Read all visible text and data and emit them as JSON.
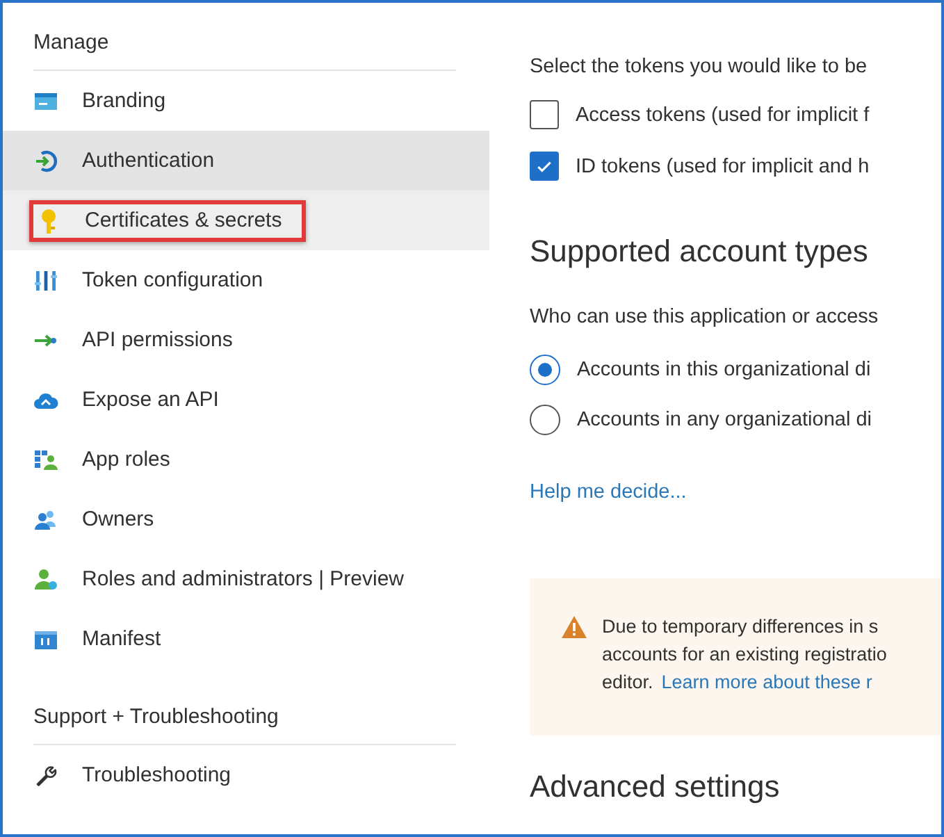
{
  "sidebar": {
    "sections": [
      {
        "title": "Manage",
        "items": [
          {
            "label": "Branding",
            "hovered": false,
            "selected": false,
            "annotated": false
          },
          {
            "label": "Authentication",
            "hovered": true,
            "selected": false,
            "annotated": false
          },
          {
            "label": "Certificates & secrets",
            "hovered": false,
            "selected": true,
            "annotated": true
          },
          {
            "label": "Token configuration",
            "hovered": false,
            "selected": false,
            "annotated": false
          },
          {
            "label": "API permissions",
            "hovered": false,
            "selected": false,
            "annotated": false
          },
          {
            "label": "Expose an API",
            "hovered": false,
            "selected": false,
            "annotated": false
          },
          {
            "label": "App roles",
            "hovered": false,
            "selected": false,
            "annotated": false
          },
          {
            "label": "Owners",
            "hovered": false,
            "selected": false,
            "annotated": false
          },
          {
            "label": "Roles and administrators | Preview",
            "hovered": false,
            "selected": false,
            "annotated": false
          },
          {
            "label": "Manifest",
            "hovered": false,
            "selected": false,
            "annotated": false
          }
        ]
      },
      {
        "title": "Support + Troubleshooting",
        "items": [
          {
            "label": "Troubleshooting",
            "hovered": false,
            "selected": false,
            "annotated": false
          }
        ]
      }
    ]
  },
  "main": {
    "tokens_prompt": "Select the tokens you would like to be",
    "tokens": [
      {
        "label": "Access tokens (used for implicit f",
        "checked": false
      },
      {
        "label": "ID tokens (used for implicit and h",
        "checked": true
      }
    ],
    "account_types": {
      "heading": "Supported account types",
      "prompt": "Who can use this application or access",
      "options": [
        {
          "label": "Accounts in this organizational di",
          "selected": true
        },
        {
          "label": "Accounts in any organizational di",
          "selected": false
        }
      ],
      "help_link": "Help me decide..."
    },
    "warning": {
      "lines": [
        "Due to temporary differences in s",
        "accounts for an existing registratio"
      ],
      "last_line": "editor.",
      "link": "Learn more about these r"
    },
    "advanced_heading": "Advanced settings"
  }
}
